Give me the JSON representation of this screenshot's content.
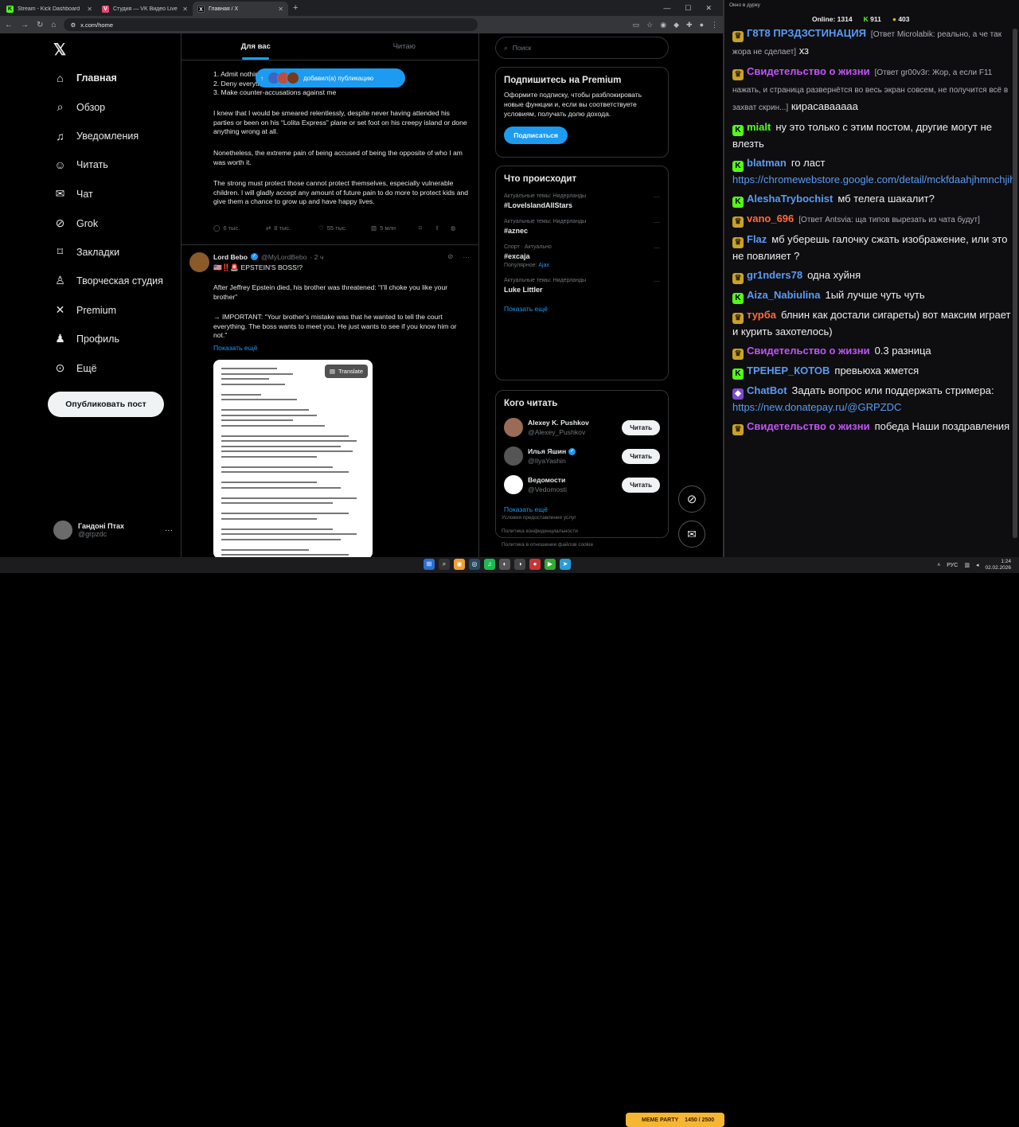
{
  "browser": {
    "tabs": [
      {
        "title": "Stream - Kick Dashboard",
        "favicon": "K",
        "color": "#53fc18"
      },
      {
        "title": "Студия — VK Видео Live",
        "favicon": "V",
        "color": "#e6466e"
      },
      {
        "title": "Главная / X",
        "favicon": "X",
        "color": "#000000"
      }
    ],
    "url": "x.com/home"
  },
  "x": {
    "nav": [
      {
        "label": "Главная",
        "icon": "home-icon",
        "glyph": "⌂"
      },
      {
        "label": "Обзор",
        "icon": "search-icon",
        "glyph": "⌕"
      },
      {
        "label": "Уведомления",
        "icon": "bell-icon",
        "glyph": "♫"
      },
      {
        "label": "Читать",
        "icon": "follow-icon",
        "glyph": "☺"
      },
      {
        "label": "Чат",
        "icon": "mail-icon",
        "glyph": "✉"
      },
      {
        "label": "Grok",
        "icon": "grok-icon",
        "glyph": "⊘"
      },
      {
        "label": "Закладки",
        "icon": "bookmark-icon",
        "glyph": "⌑"
      },
      {
        "label": "Творческая студия",
        "icon": "studio-icon",
        "glyph": "♙"
      },
      {
        "label": "Premium",
        "icon": "x-icon",
        "glyph": "✕"
      },
      {
        "label": "Профиль",
        "icon": "profile-icon",
        "glyph": "♟"
      },
      {
        "label": "Ещё",
        "icon": "more-icon",
        "glyph": "⊙"
      }
    ],
    "post_button": "Опубликовать пост",
    "account": {
      "name": "Гандоні Птах",
      "handle": "@grpzdc"
    },
    "tabs": [
      "Для вас",
      "Читаю"
    ],
    "new_posts_pill": "добавил(а) публикацию",
    "post1": {
      "lines": [
        "1. Admit nothing",
        "2. Deny everything",
        "3. Make counter-accusations against me"
      ],
      "paragraphs": [
        "I knew that I would be smeared relentlessly, despite never having attended his parties or been on his “Lolita Express” plane or set foot on his creepy island or done anything wrong at all.",
        "Nonetheless, the extreme pain of being accused of being the opposite of who I am was worth it.",
        "The strong must protect those cannot protect themselves, especially vulnerable children. I will gladly accept any amount of future pain to do more to protect kids and give them a chance to grow up and have happy lives."
      ],
      "replies": "6 тыс.",
      "reposts": "8 тыс.",
      "likes": "55 тыс.",
      "views": "5 млн"
    },
    "post2": {
      "author": "Lord Bebo",
      "handle": "@MyLordBebo",
      "time": "· 2 ч",
      "headline": "🇺🇸‼️🚨 EPSTEIN'S BOSS!?",
      "p1": "After Jeffrey Epstein died, his brother was threatened: “I’ll choke you like your brother”",
      "p2": "→ IMPORTANT: “Your brother's mistake was that he wanted to tell the court everything. The boss wants to meet you. He just wants to see if you know him or not.”",
      "show_more": "Показать ещё",
      "translate": "Translate"
    },
    "search_placeholder": "Поиск",
    "premium": {
      "title": "Подпишитесь на Premium",
      "text": "Оформите подписку, чтобы разблокировать новые функции и, если вы соответствуете условиям, получать долю дохода.",
      "button": "Подписаться"
    },
    "trends": {
      "title": "Что происходит",
      "items": [
        {
          "context": "Актуальные темы: Нидерланды",
          "name": "#LoveIslandAllStars",
          "popular": ""
        },
        {
          "context": "Актуальные темы: Нидерланды",
          "name": "#aznec",
          "popular": ""
        },
        {
          "context": "Спорт · Актуально",
          "name": "#excaja",
          "popular": "Популярное: ",
          "popular_link": "Ajax"
        },
        {
          "context": "Актуальные темы: Нидерланды",
          "name": "Luke Littler",
          "popular": ""
        }
      ],
      "show_more": "Показать ещё"
    },
    "who_to_follow": {
      "title": "Кого читать",
      "items": [
        {
          "name": "Alexey K. Pushkov",
          "handle": "@Alexey_Pushkov",
          "verified": false,
          "color": "#9a6b55"
        },
        {
          "name": "Илья Яшин",
          "handle": "@IlyaYashin",
          "verified": true,
          "color": "#555555"
        },
        {
          "name": "Ведомости",
          "handle": "@Vedomosti",
          "verified": false,
          "color": "#ffffff"
        }
      ],
      "button": "Читать",
      "show_more": "Показать ещё"
    },
    "footer": [
      "Условия предоставления услуг",
      "Политика конфиденциальности",
      "Политика в отношении файлов cookie"
    ]
  },
  "chat": {
    "window_title": "Окно в дурку",
    "online_label": "Online:",
    "online": "1314",
    "kick_count": "911",
    "other_count": "403",
    "messages": [
      {
        "user": "Г8Т8 ПРЗДЗСТИНАЦИЯ",
        "color": "#5a9bf5",
        "badge": "gold",
        "reply": "[Ответ Microlabik: реально, а че так жора не сделает]",
        "text": "хз"
      },
      {
        "user": "Свидетельство о жизни",
        "color": "#c154f5",
        "badge": "gold",
        "reply": "[Ответ gr00v3r: Жор, а если F11 нажать, и страница развернётся во весь экран совсем, не получится всё в захват скрин...]",
        "text": "кирасавааааа"
      },
      {
        "user": "mialt",
        "color": "#53fc18",
        "badge": "kick",
        "reply": "",
        "text": "ну это только с этим постом, другие могут не влезть"
      },
      {
        "user": "blatman",
        "color": "#5a9bf5",
        "badge": "kick",
        "reply": "",
        "text": "го ласт",
        "link": "https://chromewebstore.google.com/detail/mckfdaahjhmnchjihlj..."
      },
      {
        "user": "AleshaTrybochist",
        "color": "#5a9bf5",
        "badge": "kick",
        "reply": "",
        "text": "мб телега шакалит?"
      },
      {
        "user": "vano_696",
        "color": "#ff6a3d",
        "badge": "gold",
        "reply": "[Ответ Antsvia: ща типов вырезать из чата будут]",
        "text": ""
      },
      {
        "user": "Flaz",
        "color": "#5a9bf5",
        "badge": "gold",
        "reply": "",
        "text": "мб уберешь галочку сжать изображение, или это не повлияет ?"
      },
      {
        "user": "gr1nders78",
        "color": "#5a9bf5",
        "badge": "gold",
        "reply": "",
        "text": "одна хуйня"
      },
      {
        "user": "Aiza_Nabiulina",
        "color": "#5a9bf5",
        "badge": "kick",
        "reply": "",
        "text": "1ый лучше чуть чуть"
      },
      {
        "user": "турба",
        "color": "#ff6a3d",
        "badge": "gold",
        "reply": "",
        "text": "блнин как достали сигареты) вот максим играет и курить захотелось)"
      },
      {
        "user": "Свидетельство о жизни",
        "color": "#c154f5",
        "badge": "gold",
        "reply": "",
        "text": "0.3 разница"
      },
      {
        "user": "ТРЕНЕР_КОТОВ",
        "color": "#5a9bf5",
        "badge": "kick",
        "reply": "",
        "text": "превьюха жмется"
      },
      {
        "user": "ChatBot",
        "color": "#5a9bf5",
        "badge": "bot",
        "reply": "",
        "text": "Задать вопрос или поддержать стримера:",
        "link": "https://new.donatepay.ru/@GRPZDC"
      },
      {
        "user": "Свидетельство о жизни",
        "color": "#c154f5",
        "badge": "gold",
        "reply": "",
        "text": "победа Наши поздравления"
      }
    ]
  },
  "taskbar": {
    "meme_widget": "MEME PARTY",
    "meme_progress": "1450 / 2500",
    "lang": "РУС",
    "time": "1:24",
    "date": "02.02.2026"
  }
}
